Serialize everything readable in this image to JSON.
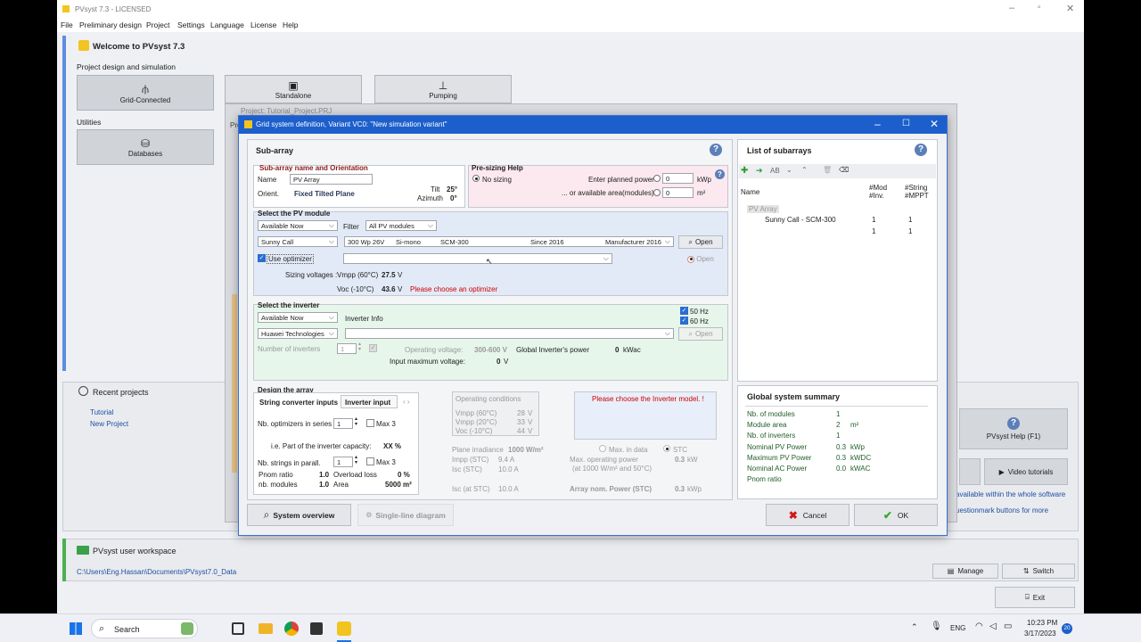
{
  "app": {
    "title": "PVsyst 7.3 - LICENSED",
    "menu": [
      "File",
      "Preliminary design",
      "Project",
      "Settings",
      "Language",
      "License",
      "Help"
    ],
    "welcome": "Welcome to PVsyst 7.3",
    "section_design": "Project design and simulation",
    "tiles": [
      "Grid-Connected",
      "Standalone",
      "Pumping"
    ],
    "section_utilities": "Utilities",
    "databases": "Databases",
    "recent_title": "Recent projects",
    "recent_items": [
      "Tutorial",
      "New Project"
    ],
    "workspace_title": "PVsyst user workspace",
    "workspace_path": "C:\\Users\\Eng.Hassan\\Documents\\PVsyst7.0_Data",
    "help_btn": "PVsyst Help (F1)",
    "video_btn": "Video tutorials",
    "info_line1": "available within the whole software",
    "info_line2": "uestionmark buttons for more",
    "manage": "Manage",
    "switch": "Switch",
    "exit": "Exit",
    "back_project": "Project:  Tutorial_Project.PRJ",
    "back_pro": "Pro"
  },
  "dialog": {
    "title": "Grid system definition, Variant VC0:  \"New simulation variant\"",
    "subarray_heading": "Sub-array",
    "name_orient": {
      "heading": "Sub-array name and Orientation",
      "name_label": "Name",
      "name_value": "PV Array",
      "orient_label": "Orient.",
      "orient_value": "Fixed Tilted Plane",
      "tilt_label": "Tilt",
      "tilt_value": "25°",
      "azimuth_label": "Azimuth",
      "azimuth_value": "0°"
    },
    "presizing": {
      "heading": "Pre-sizing Help",
      "no_sizing": "No sizing",
      "planned_label": "Enter planned power",
      "planned_value": "0",
      "planned_unit": "kWp",
      "area_label": "... or available area(modules)",
      "area_value": "0",
      "area_unit": "m²"
    },
    "module": {
      "heading": "Select the PV module",
      "availability": "Available Now",
      "filter_label": "Filter",
      "filter_value": "All PV modules",
      "manufacturer": "Sunny Call",
      "model": "300 Wp 26V",
      "tech": "Si-mono",
      "model_code": "SCM-300",
      "since": "Since 2016",
      "source": "Manufacturer 2016",
      "open": "Open",
      "use_optimizer": "Use optimizer",
      "open2": "Open",
      "sizing_label": "Sizing voltages :",
      "vmpp_label": "Vmpp (60°C)",
      "vmpp_value": "27.5",
      "vmpp_unit": "V",
      "voc_label": "Voc (-10°C)",
      "voc_value": "43.6",
      "voc_unit": "V",
      "warning": "Please choose an optimizer"
    },
    "inverter": {
      "heading": "Select the inverter",
      "availability": "Available Now",
      "info": "Inverter Info",
      "hz50": "50 Hz",
      "hz60": "60 Hz",
      "manufacturer": "Huawei Technologies",
      "open": "Open",
      "num_label": "Number of inverters",
      "num_value": "1",
      "op_voltage_label": "Operating voltage:",
      "op_voltage_value": "300-600 V",
      "global_power_label": "Global Inverter's power",
      "global_power_value": "0",
      "global_power_unit": "kWac",
      "max_input_label": "Input maximum voltage:",
      "max_input_value": "0",
      "max_input_unit": "V"
    },
    "design": {
      "heading": "Design the array",
      "tab1": "String converter inputs",
      "tab2": "Inverter input",
      "opt_series_label": "Nb. optimizers in series",
      "opt_series_value": "1",
      "max3": "Max 3",
      "capacity_label": "i.e. Part of the inverter capacity:",
      "capacity_value": "XX %",
      "strings_label": "Nb. strings in parall.",
      "strings_value": "1",
      "max3b": "Max 3",
      "pnom_label": "Pnom ratio",
      "pnom_value": "1.0",
      "overload_label": "Overload loss",
      "overload_value": "0 %",
      "nbmod_label": "nb. modules",
      "nbmod_value": "1.0",
      "area_label": "Area",
      "area_value": "5000 m²",
      "opcond_title": "Operating conditions",
      "op_vmpp60": "Vmpp (60°C)",
      "op_vmpp60_v": "28",
      "op_vmpp20": "Vmpp (20°C)",
      "op_vmpp20_v": "33",
      "op_voc": "Voc (-10°C)",
      "op_voc_v": "44",
      "unit_v": "V",
      "choose_inverter": "Please choose the Inverter model. !",
      "irr_label": "Plane irradiance",
      "irr_value": "1000 W/m²",
      "max_in_data": "Max. in data",
      "stc": "STC",
      "impp_label": "Impp (STC)",
      "impp_value": "9.4 A",
      "isc_label": "Isc (STC)",
      "isc_value": "10.0 A",
      "max_op_power": "Max. operating power",
      "max_op_sub": "(at 1000 W/m² and 50°C)",
      "max_op_value": "0.3",
      "kw": "kW",
      "isc_at_label": "Isc (at STC)",
      "isc_at_value": "10.0 A",
      "nom_power_label": "Array nom. Power (STC)",
      "nom_power_value": "0.3",
      "kwp": "kWp"
    },
    "list": {
      "heading": "List of subarrays",
      "col_name": "Name",
      "col_mod1": "#Mod",
      "col_mod2": "#Inv.",
      "col_str1": "#String",
      "col_str2": "#MPPT",
      "group": "PV Array",
      "row1_name": "Sunny Call - SCM-300",
      "row1_a": "1",
      "row1_b": "1",
      "row2_a": "1",
      "row2_b": "1"
    },
    "summary": {
      "heading": "Global system summary",
      "rows": [
        {
          "label": "Nb. of modules",
          "value": "1",
          "unit": ""
        },
        {
          "label": "Module area",
          "value": "2",
          "unit": "m²"
        },
        {
          "label": "Nb. of inverters",
          "value": "1",
          "unit": ""
        },
        {
          "label": "Nominal PV Power",
          "value": "0.3",
          "unit": "kWp"
        },
        {
          "label": "Maximum PV Power",
          "value": "0.3",
          "unit": "kWDC"
        },
        {
          "label": "Nominal AC Power",
          "value": "0.0",
          "unit": "kWAC"
        },
        {
          "label": "Pnom ratio",
          "value": "",
          "unit": ""
        }
      ]
    },
    "system_overview": "System overview",
    "single_line": "Single-line diagram",
    "cancel": "Cancel",
    "ok": "OK"
  },
  "taskbar": {
    "search": "Search",
    "lang": "ENG",
    "time": "10:23 PM",
    "date": "3/17/2023",
    "badge": "20"
  }
}
